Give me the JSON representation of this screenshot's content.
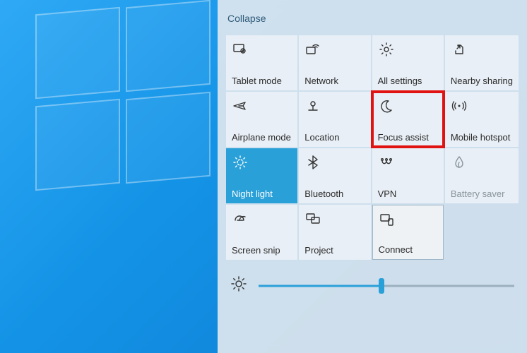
{
  "collapse_label": "Collapse",
  "colors": {
    "accent": "#2aa0d8",
    "highlight": "#e11212"
  },
  "tiles": [
    {
      "id": "tablet-mode",
      "label": "Tablet mode",
      "icon": "tablet-mode-icon",
      "state": "off"
    },
    {
      "id": "network",
      "label": "Network",
      "icon": "network-icon",
      "state": "off"
    },
    {
      "id": "all-settings",
      "label": "All settings",
      "icon": "gear-icon",
      "state": "off"
    },
    {
      "id": "nearby-sharing",
      "label": "Nearby sharing",
      "icon": "nearby-sharing-icon",
      "state": "off"
    },
    {
      "id": "airplane-mode",
      "label": "Airplane mode",
      "icon": "airplane-icon",
      "state": "off"
    },
    {
      "id": "location",
      "label": "Location",
      "icon": "location-icon",
      "state": "off"
    },
    {
      "id": "focus-assist",
      "label": "Focus assist",
      "icon": "moon-icon",
      "state": "off",
      "highlighted": true
    },
    {
      "id": "mobile-hotspot",
      "label": "Mobile hotspot",
      "icon": "hotspot-icon",
      "state": "off"
    },
    {
      "id": "night-light",
      "label": "Night light",
      "icon": "night-light-icon",
      "state": "on"
    },
    {
      "id": "bluetooth",
      "label": "Bluetooth",
      "icon": "bluetooth-icon",
      "state": "off"
    },
    {
      "id": "vpn",
      "label": "VPN",
      "icon": "vpn-icon",
      "state": "off"
    },
    {
      "id": "battery-saver",
      "label": "Battery saver",
      "icon": "battery-saver-icon",
      "state": "disabled"
    },
    {
      "id": "screen-snip",
      "label": "Screen snip",
      "icon": "screen-snip-icon",
      "state": "off"
    },
    {
      "id": "project",
      "label": "Project",
      "icon": "project-icon",
      "state": "off"
    },
    {
      "id": "connect",
      "label": "Connect",
      "icon": "connect-icon",
      "state": "off",
      "selected_frame": true
    }
  ],
  "brightness": {
    "icon": "brightness-icon",
    "value_percent": 48
  }
}
